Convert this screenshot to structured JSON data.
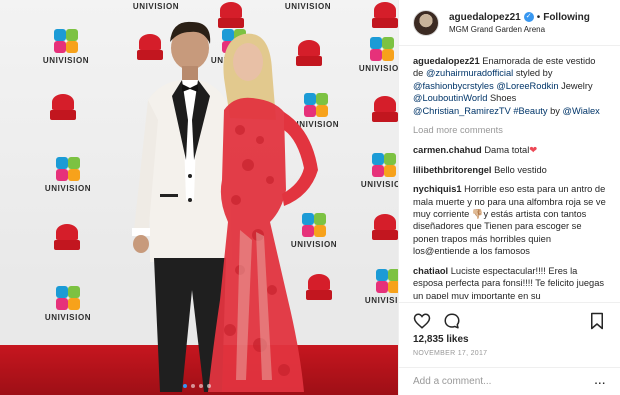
{
  "header": {
    "username": "aguedalopez21",
    "verified_icon": "verified-badge-icon",
    "separator": "•",
    "follow_label": "Following",
    "location": "MGM Grand Garden Arena"
  },
  "caption": {
    "username": "aguedalopez21",
    "t1": " Enamorada de este vestido de ",
    "m1": "@zuhairmuradofficial",
    "t2": " styled by ",
    "m2": "@fashionbycrstyles",
    "t3": " ",
    "m3": "@LoreeRodkin",
    "t4": " Jewelry ",
    "m4": "@LouboutinWorld",
    "t5": " Shoes ",
    "m5": "@Christian_RamirezTV",
    "t6": " ",
    "m6": "#Beauty",
    "t7": " by ",
    "m7": "@Wialex"
  },
  "load_more": "Load more comments",
  "comments": [
    {
      "user": "carmen.chahud",
      "text": "Dama total",
      "emoji": "❤"
    },
    {
      "user": "lilibethbritorengel",
      "text": "Bello vestido",
      "emoji": ""
    },
    {
      "user": "nychiquis1",
      "text": "Horrible eso esta para un antro de mala muerte y no para una alfombra roja se ve muy corriente ",
      "emoji": "👎🏼",
      "text2": "y estás artista con tantos diseñadores que Tienen para escoger se ponen trapos más horribles quien los@entiende a los famosos"
    },
    {
      "user": "chatiaol",
      "text": "Luciste espectacular!!!! Eres la esposa perfecta para fonsi!!!! Te felicito juegas un papel muy importante en su",
      "emoji": ""
    }
  ],
  "actions": {
    "like_icon": "heart-outline-icon",
    "comment_icon": "comment-bubble-icon",
    "save_icon": "bookmark-icon"
  },
  "likes": "12,835 likes",
  "date": "NOVEMBER 17, 2017",
  "add_comment_placeholder": "Add a comment...",
  "more_label": "...",
  "photo": {
    "carousel_dots": 4,
    "active_dot": 0,
    "backdrop_brand": "UNIVISION",
    "colors": {
      "carpet": "#c6161f",
      "dress": "#e2343f",
      "tux_jacket": "#f4f1ec"
    }
  }
}
